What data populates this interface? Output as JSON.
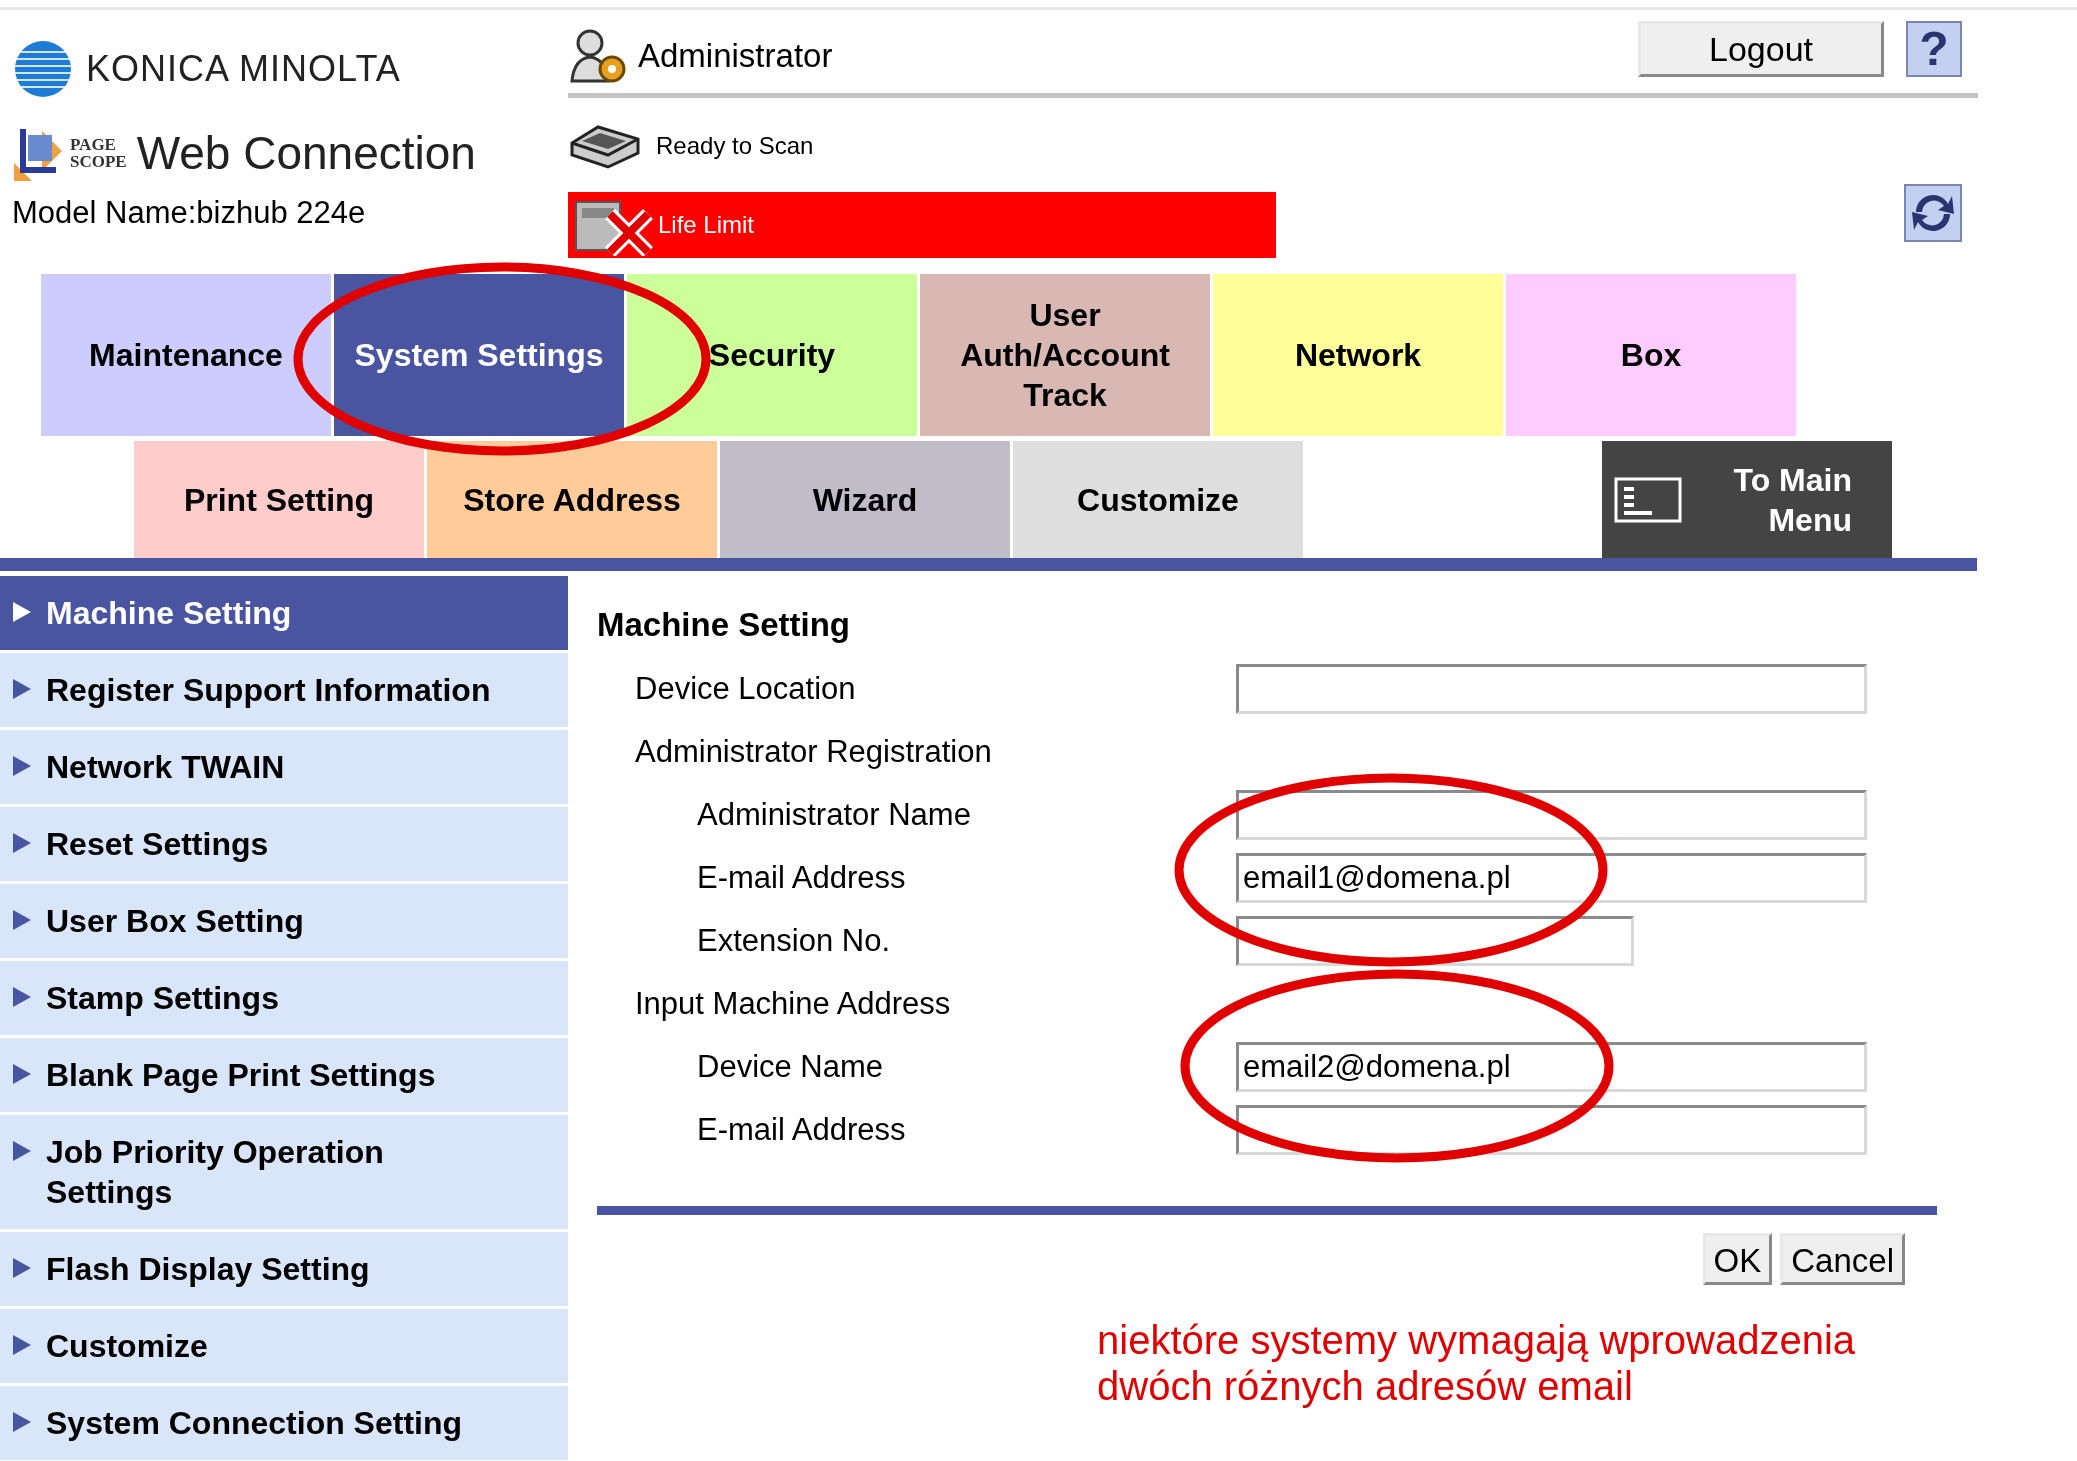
{
  "header": {
    "brand": "KONICA MINOLTA",
    "product_logo": [
      "PAGE",
      "SCOPE"
    ],
    "product": "Web Connection",
    "model": "Model Name:bizhub 224e",
    "user": "Administrator",
    "logout": "Logout",
    "help": "?",
    "status": "Ready to Scan",
    "alert": "Life Limit"
  },
  "tabs": [
    {
      "label": "Maintenance",
      "selected": false,
      "color": "#ccccff"
    },
    {
      "label": "System Settings",
      "selected": true,
      "color": "#4a55a2"
    },
    {
      "label": "Security",
      "selected": false,
      "color": "#ccff99"
    },
    {
      "label": "User Auth/Account Track",
      "selected": false,
      "color": "#d9b8b3"
    },
    {
      "label": "Network",
      "selected": false,
      "color": "#ffff99"
    },
    {
      "label": "Box",
      "selected": false,
      "color": "#ffccff"
    }
  ],
  "subtabs": [
    {
      "label": "Print Setting",
      "color": "#ffcccc"
    },
    {
      "label": "Store Address",
      "color": "#ffcc99"
    },
    {
      "label": "Wizard",
      "color": "#c0bcc8"
    },
    {
      "label": "Customize",
      "color": "#dedede"
    }
  ],
  "main_menu": "To Main Menu",
  "sidebar": {
    "items": [
      {
        "label": "Machine Setting",
        "selected": true
      },
      {
        "label": "Register Support Information",
        "selected": false
      },
      {
        "label": "Network TWAIN",
        "selected": false
      },
      {
        "label": "Reset Settings",
        "selected": false
      },
      {
        "label": "User Box Setting",
        "selected": false
      },
      {
        "label": "Stamp Settings",
        "selected": false
      },
      {
        "label": "Blank Page Print Settings",
        "selected": false
      },
      {
        "label": "Job Priority Operation Settings",
        "selected": false
      },
      {
        "label": "Flash Display Setting",
        "selected": false
      },
      {
        "label": "Customize",
        "selected": false
      },
      {
        "label": "System Connection Setting",
        "selected": false
      }
    ]
  },
  "form": {
    "title": "Machine Setting",
    "rows": [
      {
        "kind": "field",
        "label": "Device Location"
      },
      {
        "kind": "group",
        "label": "Administrator Registration",
        "children": [
          {
            "kind": "field",
            "label": "Administrator Name"
          },
          {
            "kind": "field",
            "label": "E-mail Address",
            "value": "email1@domena.pl"
          },
          {
            "kind": "short_field",
            "label": "Extension No."
          }
        ]
      },
      {
        "kind": "group",
        "label": "Input Machine Address",
        "children": [
          {
            "kind": "field",
            "label": "Device Name",
            "value": "email2@domena.pl"
          },
          {
            "kind": "field",
            "label": "E-mail Address"
          }
        ]
      }
    ],
    "buttons": [
      "OK",
      "Cancel"
    ]
  },
  "annotation": {
    "lines": [
      "niektóre systemy wymagają wprowadzenia",
      "dwóch różnych adresów email"
    ]
  }
}
